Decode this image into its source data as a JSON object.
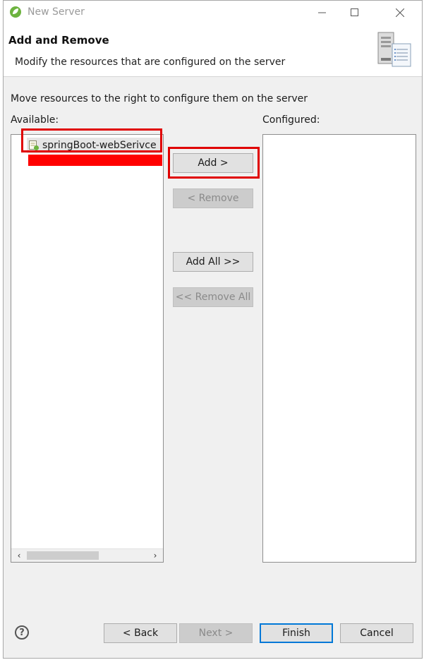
{
  "window": {
    "title": "New Server",
    "min_icon": "minimize-icon",
    "max_icon": "maximize-icon",
    "close_icon": "close-icon"
  },
  "banner": {
    "title": "Add and Remove",
    "description": "Modify the resources that are configured on the server",
    "icon": "server-icon"
  },
  "instruction": "Move resources to the right to configure them on the server",
  "available": {
    "label": "Available:",
    "items": [
      {
        "label": "springBoot-webSerivce",
        "icon": "project-icon",
        "selected": true
      }
    ],
    "redacted_item_color": "#ff0000"
  },
  "configured": {
    "label": "Configured:",
    "items": []
  },
  "actions": {
    "add": "Add >",
    "remove": "< Remove",
    "add_all": "Add All >>",
    "remove_all": "<< Remove All"
  },
  "footer": {
    "help_icon": "help-icon",
    "back": "< Back",
    "next": "Next >",
    "finish": "Finish",
    "cancel": "Cancel"
  },
  "colors": {
    "highlight": "#e00000",
    "default_button_border": "#0078d7",
    "window_background": "#f0f0f0"
  }
}
